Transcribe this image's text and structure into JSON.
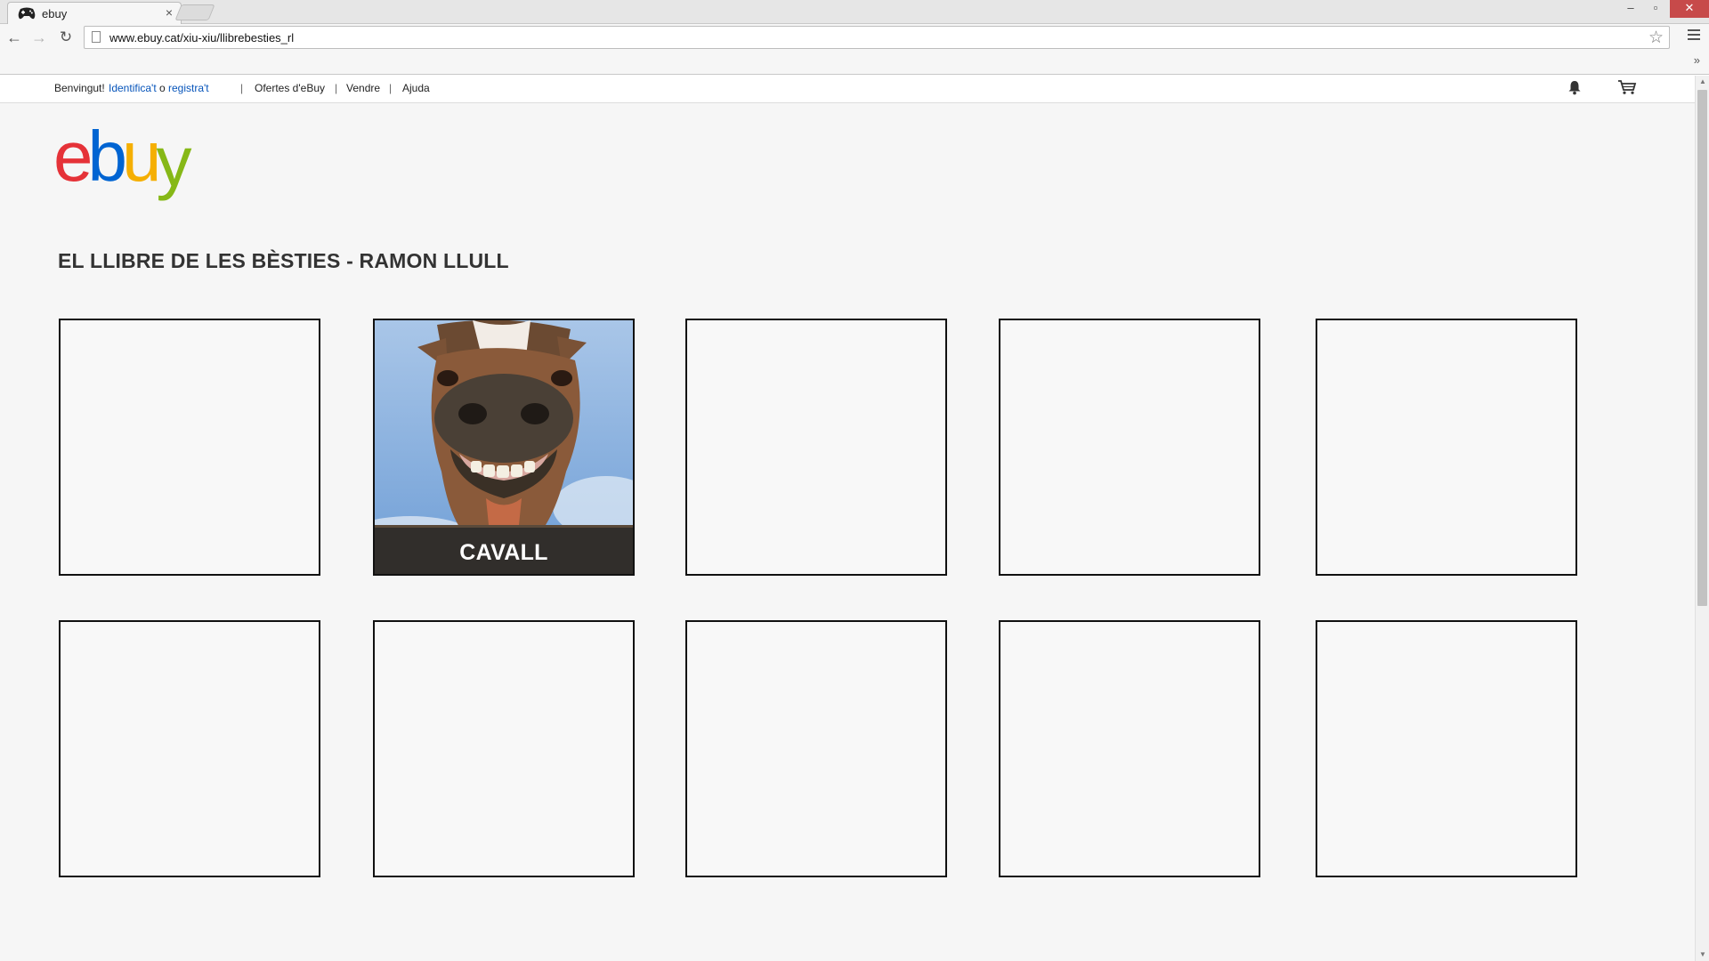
{
  "browser": {
    "tab_title": "ebuy",
    "tab_close_glyph": "×",
    "url": "www.ebuy.cat/xiu-xiu/llibrebesties_rl",
    "window_controls": {
      "minimize": "–",
      "maximize": "▫",
      "close": "✕"
    },
    "bookmarks_chevron": "»"
  },
  "site_nav": {
    "greeting": "Benvingut!",
    "signin_link": "Identifica't",
    "or_text": "o",
    "register_link": "registra't",
    "separator": "|",
    "links": [
      "Ofertes d'eBuy",
      "Vendre",
      "Ajuda"
    ]
  },
  "logo": {
    "text": "ebuy",
    "colors": [
      "#e53238",
      "#0064d2",
      "#f5af02",
      "#86b817"
    ]
  },
  "page": {
    "title": "EL LLIBRE DE LES BÈSTIES - RAMON LLULL",
    "tiles": [
      {
        "label": ""
      },
      {
        "label": "CAVALL",
        "image": "laughing-horse-photo"
      },
      {
        "label": ""
      },
      {
        "label": ""
      },
      {
        "label": ""
      },
      {
        "label": ""
      },
      {
        "label": ""
      },
      {
        "label": ""
      },
      {
        "label": ""
      },
      {
        "label": ""
      }
    ]
  },
  "icons": {
    "favicon": "gamepad-icon",
    "bell": "bell-icon",
    "cart": "cart-icon",
    "star": "star-icon",
    "menu": "menu-icon"
  }
}
